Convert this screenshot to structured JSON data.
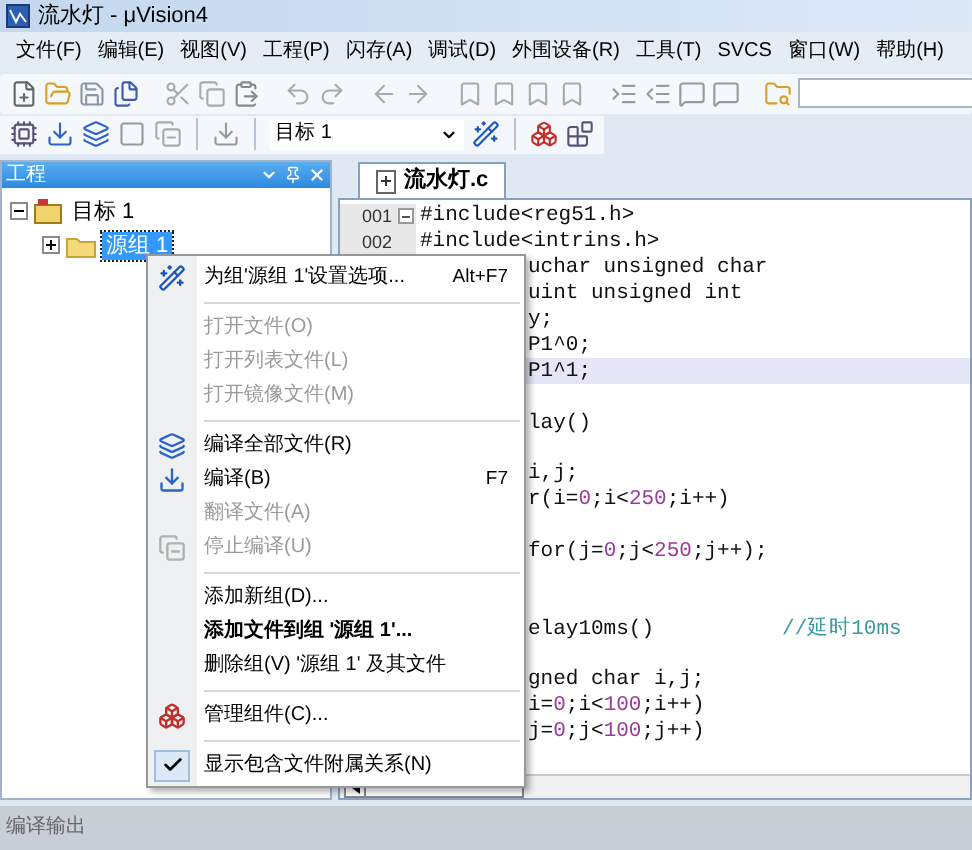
{
  "window": {
    "title": "流水灯 - μVision4"
  },
  "menu_bar": [
    {
      "label": "文件(F)"
    },
    {
      "label": "编辑(E)"
    },
    {
      "label": "视图(V)"
    },
    {
      "label": "工程(P)"
    },
    {
      "label": "闪存(A)"
    },
    {
      "label": "调试(D)"
    },
    {
      "label": "外围设备(R)"
    },
    {
      "label": "工具(T)"
    },
    {
      "label": "SVCS"
    },
    {
      "label": "窗口(W)"
    },
    {
      "label": "帮助(H)"
    }
  ],
  "toolbar": {
    "target": "目标 1"
  },
  "project_panel": {
    "title": "工程",
    "tree": [
      {
        "label": "目标 1",
        "expanded": true,
        "selected": false,
        "children": [
          {
            "label": "源组 1",
            "expanded": false,
            "selected": true
          }
        ]
      }
    ]
  },
  "editor": {
    "tabs": [
      {
        "label": "流水灯.c",
        "selected": true
      }
    ],
    "line_numbers": [
      "001",
      "002"
    ],
    "lines": [
      {
        "kind": "full",
        "highlighted": false,
        "tokens": [
          {
            "kind": "plain",
            "text": "#include<reg51.h>"
          }
        ]
      },
      {
        "kind": "full",
        "highlighted": false,
        "tokens": [
          {
            "kind": "plain",
            "text": "#include<intrins.h>"
          }
        ]
      },
      {
        "kind": "partial",
        "highlighted": false,
        "tokens": [
          {
            "kind": "plain",
            "text": "uchar unsigned char"
          }
        ]
      },
      {
        "kind": "partial",
        "highlighted": false,
        "tokens": [
          {
            "kind": "plain",
            "text": "uint unsigned int"
          }
        ]
      },
      {
        "kind": "partial",
        "highlighted": false,
        "tokens": [
          {
            "kind": "plain",
            "text": "y;"
          }
        ]
      },
      {
        "kind": "partial",
        "highlighted": false,
        "tokens": [
          {
            "kind": "plain",
            "text": "P1^0;"
          }
        ]
      },
      {
        "kind": "partial",
        "highlighted": true,
        "tokens": [
          {
            "kind": "plain",
            "text": "P1^1;"
          }
        ]
      },
      {
        "kind": "blank",
        "highlighted": false
      },
      {
        "kind": "partial",
        "highlighted": false,
        "tokens": [
          {
            "kind": "plain",
            "text": "lay()"
          }
        ]
      },
      {
        "kind": "blank",
        "highlighted": false
      },
      {
        "kind": "partial",
        "highlighted": false,
        "tokens": [
          {
            "kind": "plain",
            "text": "i,j;"
          }
        ]
      },
      {
        "kind": "partial",
        "highlighted": false,
        "tokens": [
          {
            "kind": "plain",
            "text": "r(i="
          },
          {
            "kind": "number",
            "text": "0"
          },
          {
            "kind": "plain",
            "text": ";i<"
          },
          {
            "kind": "number",
            "text": "250"
          },
          {
            "kind": "plain",
            "text": ";i++)"
          }
        ]
      },
      {
        "kind": "blank",
        "highlighted": false
      },
      {
        "kind": "partial",
        "highlighted": false,
        "tokens": [
          {
            "kind": "plain",
            "text": "for(j="
          },
          {
            "kind": "number",
            "text": "0"
          },
          {
            "kind": "plain",
            "text": ";j<"
          },
          {
            "kind": "number",
            "text": "250"
          },
          {
            "kind": "plain",
            "text": ";j++);"
          }
        ]
      },
      {
        "kind": "blank",
        "highlighted": false
      },
      {
        "kind": "blank",
        "highlighted": false
      },
      {
        "kind": "partial",
        "highlighted": false,
        "tokens": [
          {
            "kind": "plain",
            "text": "elay10ms()"
          },
          {
            "kind": "comment",
            "text": "//延时10ms"
          }
        ]
      },
      {
        "kind": "blank",
        "highlighted": false
      },
      {
        "kind": "partial",
        "highlighted": false,
        "tokens": [
          {
            "kind": "plain",
            "text": "gned char i,j;"
          }
        ]
      },
      {
        "kind": "partial",
        "highlighted": false,
        "tokens": [
          {
            "kind": "plain",
            "text": "i="
          },
          {
            "kind": "number",
            "text": "0"
          },
          {
            "kind": "plain",
            "text": ";i<"
          },
          {
            "kind": "number",
            "text": "100"
          },
          {
            "kind": "plain",
            "text": ";i++)"
          }
        ]
      },
      {
        "kind": "partial",
        "highlighted": false,
        "tokens": [
          {
            "kind": "plain",
            "text": "j="
          },
          {
            "kind": "number",
            "text": "0"
          },
          {
            "kind": "plain",
            "text": ";j<"
          },
          {
            "kind": "number",
            "text": "100"
          },
          {
            "kind": "plain",
            "text": ";j++)"
          }
        ]
      }
    ]
  },
  "context_menu": {
    "items": [
      {
        "kind": "item",
        "label": "为组'源组 1'设置选项...",
        "shortcut": "Alt+F7",
        "disabled": false,
        "checked": false,
        "bold": false
      },
      {
        "kind": "separator"
      },
      {
        "kind": "item",
        "label": "打开文件(O)",
        "disabled": true,
        "checked": false,
        "bold": false
      },
      {
        "kind": "item",
        "label": "打开列表文件(L)",
        "disabled": true,
        "checked": false,
        "bold": false
      },
      {
        "kind": "item",
        "label": "打开镜像文件(M)",
        "disabled": true,
        "checked": false,
        "bold": false
      },
      {
        "kind": "separator"
      },
      {
        "kind": "item",
        "label": "编译全部文件(R)",
        "disabled": false,
        "checked": false,
        "bold": false
      },
      {
        "kind": "item",
        "label": "编译(B)",
        "shortcut": "F7",
        "disabled": false,
        "checked": false,
        "bold": false
      },
      {
        "kind": "item",
        "label": "翻译文件(A)",
        "disabled": true,
        "checked": false,
        "bold": false
      },
      {
        "kind": "item",
        "label": "停止编译(U)",
        "disabled": true,
        "checked": false,
        "bold": false
      },
      {
        "kind": "separator"
      },
      {
        "kind": "item",
        "label": "添加新组(D)...",
        "disabled": false,
        "checked": false,
        "bold": false
      },
      {
        "kind": "item",
        "label": "添加文件到组 '源组 1'...",
        "disabled": false,
        "checked": false,
        "bold": true
      },
      {
        "kind": "item",
        "label": "删除组(V) '源组 1' 及其文件",
        "disabled": false,
        "checked": false,
        "bold": false
      },
      {
        "kind": "separator"
      },
      {
        "kind": "item",
        "label": "管理组件(C)...",
        "disabled": false,
        "checked": false,
        "bold": false
      },
      {
        "kind": "separator"
      },
      {
        "kind": "item",
        "label": "显示包含文件附属关系(N)",
        "disabled": false,
        "checked": true,
        "bold": false
      }
    ]
  },
  "status_bar": {
    "label": "编译输出"
  }
}
